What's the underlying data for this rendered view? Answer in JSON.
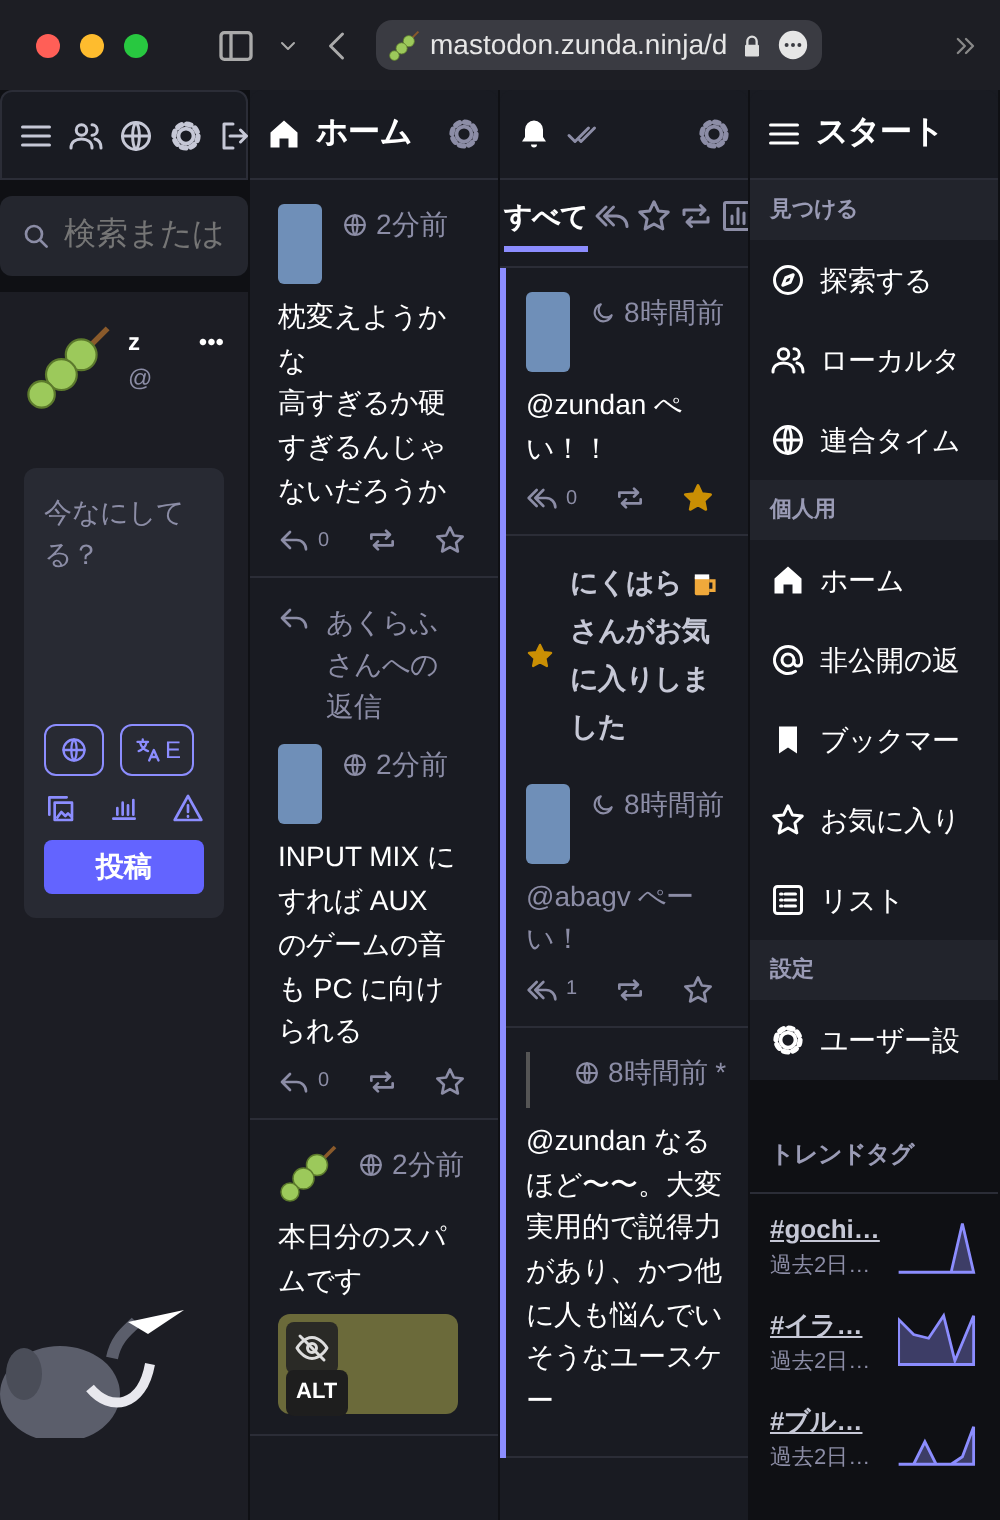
{
  "browser": {
    "url": "mastodon.zunda.ninja/d"
  },
  "nav_column": {
    "search": {
      "placeholder": "検索または"
    },
    "account": {
      "name": "z",
      "handle": "@",
      "menu": "•••"
    },
    "compose": {
      "placeholder": "今なにしてる？",
      "language": "E",
      "submit": "投稿"
    }
  },
  "home_column": {
    "title": "ホーム",
    "posts": [
      {
        "unlisted": false,
        "time": "2分前",
        "lines": [
          "枕変えようかな",
          "高すぎるか硬すぎるんじゃないだろうか"
        ],
        "replies": "0",
        "favourited": false
      },
      {
        "reply_to": "あくらふさんへの返信",
        "unlisted": false,
        "time": "2分前",
        "lines": [
          "INPUT MIX にすれば AUX のゲームの音も PC に向けられる"
        ],
        "replies": "0",
        "favourited": false
      },
      {
        "unlisted": false,
        "time": "2分前",
        "lines": [
          "本日分のスパムです"
        ],
        "media": {
          "badge": "ALT"
        }
      }
    ]
  },
  "notifications_column": {
    "filters": [
      {
        "label": "すべて",
        "selected": true
      },
      {
        "selected": false
      },
      {
        "selected": false
      },
      {
        "selected": false
      },
      {
        "selected": false
      }
    ],
    "notifications": [
      {
        "kind": "mention",
        "unread": true,
        "status": {
          "unlisted": true,
          "time": "8時間前",
          "lines": [
            "@zundan ぺい！！"
          ],
          "replies": "0",
          "favourited": true
        }
      },
      {
        "kind": "favourite",
        "unread": true,
        "account": "にくはら",
        "message": "さんがお気に入りしました",
        "status": {
          "unlisted": true,
          "time": "8時間前",
          "lines": [
            "@abagv ぺーい！"
          ],
          "replies": "1",
          "favourited": false
        }
      },
      {
        "kind": "mention",
        "unread": true,
        "status": {
          "avatar": false,
          "unlisted": false,
          "time": "8時間前 *",
          "lines": [
            "@zundan なるほど〜〜。大変実用的で説得力があり、かつ他に人も悩んでいそうなユースケー"
          ]
        }
      }
    ]
  },
  "start_column": {
    "title": "スタート",
    "sections": [
      {
        "heading": "見つける",
        "items": [
          "探索する",
          "ローカルタ",
          "連合タイム"
        ]
      },
      {
        "heading": "個人用",
        "items": [
          "ホーム",
          "非公開の返",
          "ブックマー",
          "お気に入り",
          "リスト"
        ]
      },
      {
        "heading": "設定",
        "items": [
          "ユーザー設"
        ]
      }
    ]
  },
  "trends": {
    "heading": "トレンドタグ",
    "tags": [
      {
        "name": "#gochi…",
        "period": "過去2日…"
      },
      {
        "name": "#イラ…",
        "period": "過去2日…"
      },
      {
        "name": "#ブル…",
        "period": "過去2日…"
      }
    ]
  }
}
